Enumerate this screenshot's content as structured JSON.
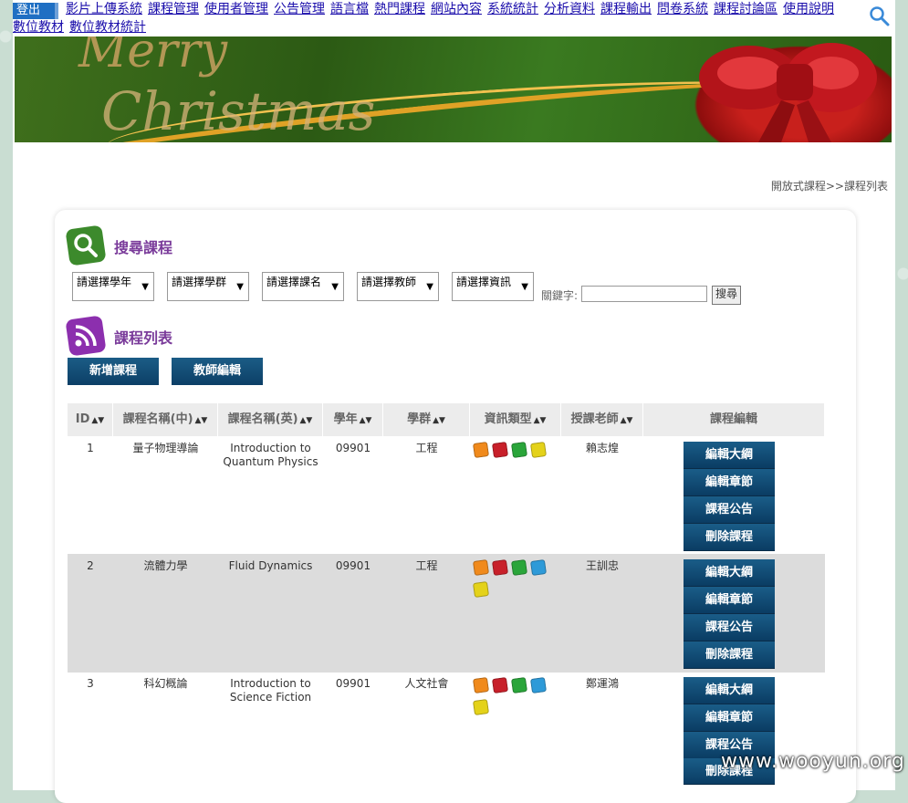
{
  "nav": {
    "logout": "登出",
    "links": [
      "影片上傳系統",
      "課程管理",
      "使用者管理",
      "公告管理",
      "語言檔",
      "熱門課程",
      "網站內容",
      "系統統計",
      "分析資料",
      "課程輸出",
      "問卷系統",
      "課程討論區",
      "使用說明"
    ],
    "links2": [
      "數位教材",
      "數位教材統計"
    ]
  },
  "banner": {
    "line1": "Merry",
    "line2": "Christmas"
  },
  "breadcrumb": "開放式課程>>課程列表",
  "search": {
    "title": "搜尋課程",
    "filters": [
      "請選擇學年",
      "請選擇學群",
      "請選擇課名",
      "請選擇教師",
      "請選擇資訊"
    ],
    "keyword_label": "關鍵字:",
    "keyword_value": "",
    "submit": "搜尋"
  },
  "list": {
    "title": "課程列表",
    "add_button": "新增課程",
    "teacher_button": "教師編輯",
    "columns": [
      "ID",
      "課程名稱(中)",
      "課程名稱(英)",
      "學年",
      "學群",
      "資訊類型",
      "授課老師",
      "課程編輯"
    ],
    "actions": [
      "編輯大綱",
      "編輯章節",
      "課程公告",
      "刪除課程"
    ],
    "rows": [
      {
        "id": "1",
        "name_zh": "量子物理導論",
        "name_en": "Introduction to Quantum Physics",
        "year": "09901",
        "group": "工程",
        "teacher": "賴志煌",
        "icons": [
          "orange",
          "red",
          "green",
          "yellow"
        ]
      },
      {
        "id": "2",
        "name_zh": "流體力學",
        "name_en": "Fluid Dynamics",
        "year": "09901",
        "group": "工程",
        "teacher": "王訓忠",
        "icons": [
          "orange",
          "red",
          "green",
          "blue",
          "yellow"
        ]
      },
      {
        "id": "3",
        "name_zh": "科幻概論",
        "name_en": "Introduction to Science Fiction",
        "year": "09901",
        "group": "人文社會",
        "teacher": "鄭運鴻",
        "icons": [
          "orange",
          "red",
          "green",
          "blue",
          "yellow"
        ]
      }
    ]
  },
  "colors": {
    "orange": "#f08a1c",
    "red": "#c8202a",
    "green": "#2aa53a",
    "blue": "#2e9ad8",
    "yellow": "#e4d21a"
  },
  "watermark": "www.wooyun.org"
}
